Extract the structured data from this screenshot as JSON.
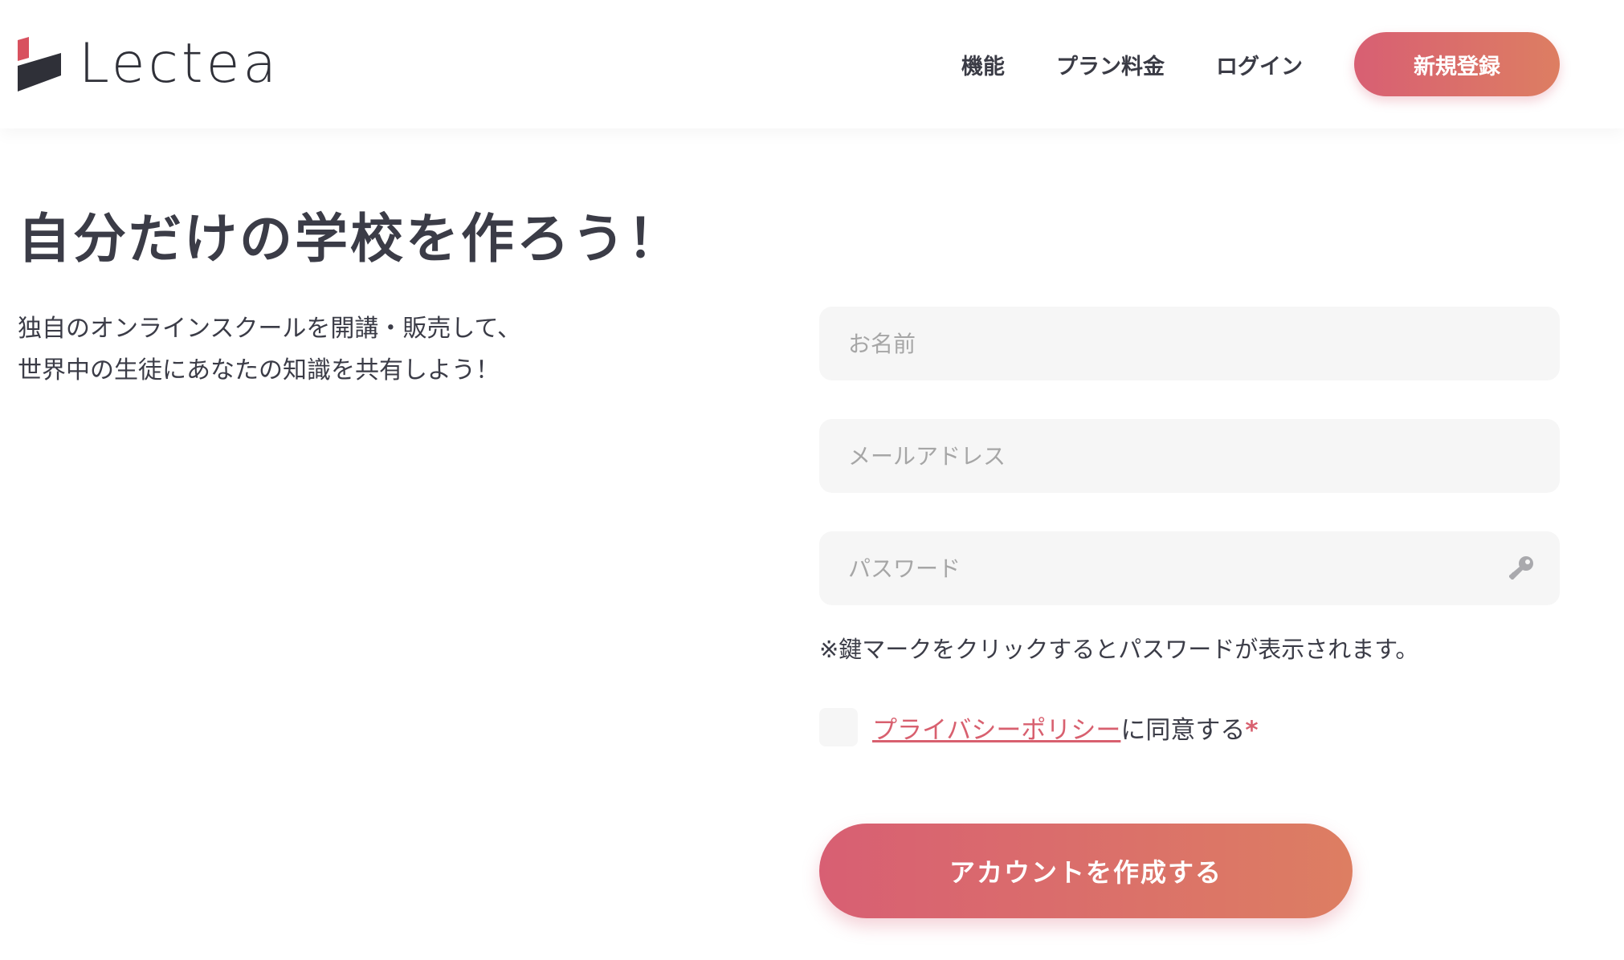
{
  "brand": {
    "name": "Lectea",
    "logo_icon": "lectea-logo-icon",
    "accent": "#d8606f",
    "accent_end": "#dd7e62"
  },
  "nav": {
    "features": "機能",
    "pricing": "プラン料金",
    "login": "ログイン",
    "signup": "新規登録"
  },
  "hero": {
    "title": "自分だけの学校を作ろう！",
    "desc_line1": "独自のオンラインスクールを開講・販売して、",
    "desc_line2": "世界中の生徒にあなたの知識を共有しよう！"
  },
  "form": {
    "name_placeholder": "お名前",
    "name_value": "",
    "email_placeholder": "メールアドレス",
    "email_value": "",
    "password_placeholder": "パスワード",
    "password_value": "",
    "password_icon": "key-icon",
    "hint": "※鍵マークをクリックするとパスワードが表示されます。",
    "policy_link": "プライバシーポリシー",
    "agree_suffix": "に同意する",
    "required_mark": "*",
    "agree_checked": false,
    "submit": "アカウントを作成する"
  }
}
